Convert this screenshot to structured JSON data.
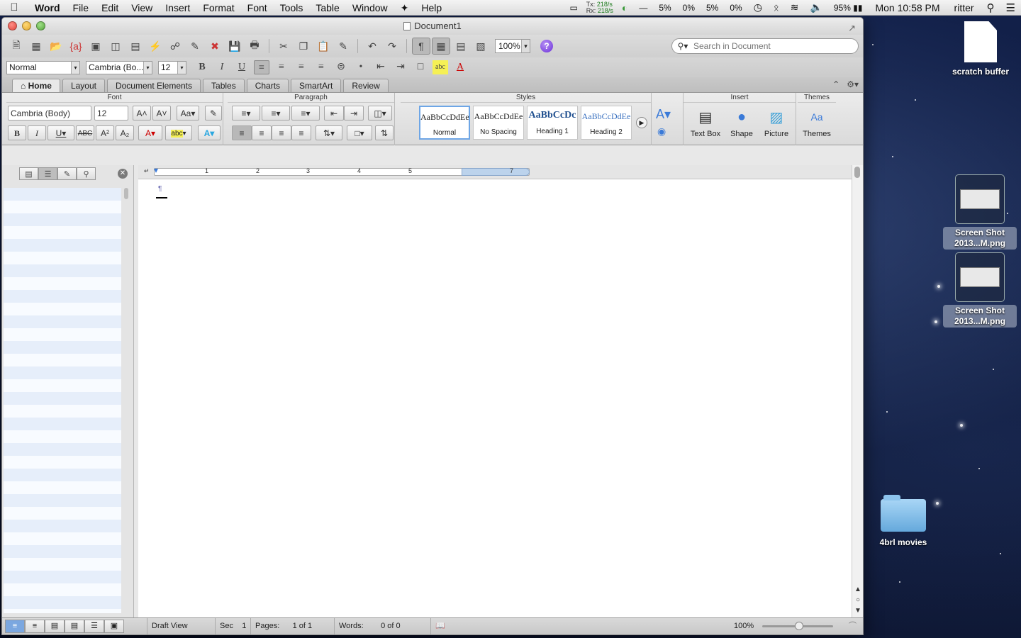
{
  "menubar": {
    "apple": "",
    "app": "Word",
    "items": [
      "File",
      "Edit",
      "View",
      "Insert",
      "Format",
      "Font",
      "Tools",
      "Table",
      "Window",
      "Help"
    ],
    "script_icon": "script-icon",
    "net_tx_label": "Tx:",
    "net_tx": "218/s",
    "net_rx_label": "Rx:",
    "net_rx": "218/s",
    "cpu": [
      "5%",
      "0%",
      "5%",
      "0%"
    ],
    "battery": "95%",
    "clock": "Mon 10:58 PM",
    "user": "ritter"
  },
  "window": {
    "title": "Document1",
    "search_placeholder": "Search in Document",
    "zoom": "100%",
    "format": {
      "style": "Normal",
      "font": "Cambria (Bo...",
      "size": "12"
    },
    "tabs": [
      "Home",
      "Layout",
      "Document Elements",
      "Tables",
      "Charts",
      "SmartArt",
      "Review"
    ],
    "ribbon": {
      "groups": {
        "font": "Font",
        "paragraph": "Paragraph",
        "styles": "Styles",
        "insert": "Insert",
        "themes": "Themes"
      },
      "font_name": "Cambria (Body)",
      "font_size": "12",
      "styles": [
        {
          "sample": "AaBbCcDdEe",
          "name": "Normal"
        },
        {
          "sample": "AaBbCcDdEe",
          "name": "No Spacing"
        },
        {
          "sample": "AaBbCcDc",
          "name": "Heading 1"
        },
        {
          "sample": "AaBbCcDdEe",
          "name": "Heading 2"
        }
      ],
      "insert_buttons": [
        "Text Box",
        "Shape",
        "Picture"
      ],
      "themes_button": "Themes"
    },
    "ruler": [
      "1",
      "2",
      "3",
      "4",
      "5",
      "7"
    ],
    "pilcrow": "¶",
    "status": {
      "view": "Draft View",
      "sec_label": "Sec",
      "sec": "1",
      "pages_label": "Pages:",
      "pages": "1 of 1",
      "words_label": "Words:",
      "words": "0 of 0",
      "zoom": "100%"
    }
  },
  "desktop": {
    "icons": [
      {
        "label": "scratch buffer"
      },
      {
        "label": "Screen Shot 2013...M.png"
      },
      {
        "label": "Screen Shot 2013...M.png"
      },
      {
        "label": "4brl movies"
      }
    ]
  },
  "colors": {
    "accent": "#6ea6e6",
    "help": "#6a2fd8",
    "close": "#e0443a",
    "minimize": "#e2a72a",
    "maximize": "#55a63a"
  }
}
